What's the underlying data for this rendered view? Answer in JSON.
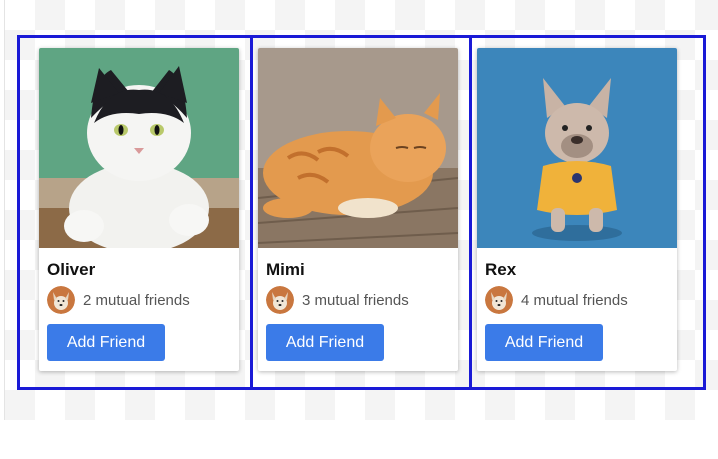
{
  "cards": [
    {
      "name": "Oliver",
      "mutual": "2 mutual friends",
      "button": "Add Friend",
      "photo_icon": "black-white-cat-photo"
    },
    {
      "name": "Mimi",
      "mutual": "3 mutual friends",
      "button": "Add Friend",
      "photo_icon": "orange-tabby-cat-photo"
    },
    {
      "name": "Rex",
      "mutual": "4 mutual friends",
      "button": "Add Friend",
      "photo_icon": "french-bulldog-photo"
    }
  ],
  "colors": {
    "button": "#3b7be8",
    "cell_outline": "#1a1ad6",
    "avatar_bg": "#c9773f"
  }
}
